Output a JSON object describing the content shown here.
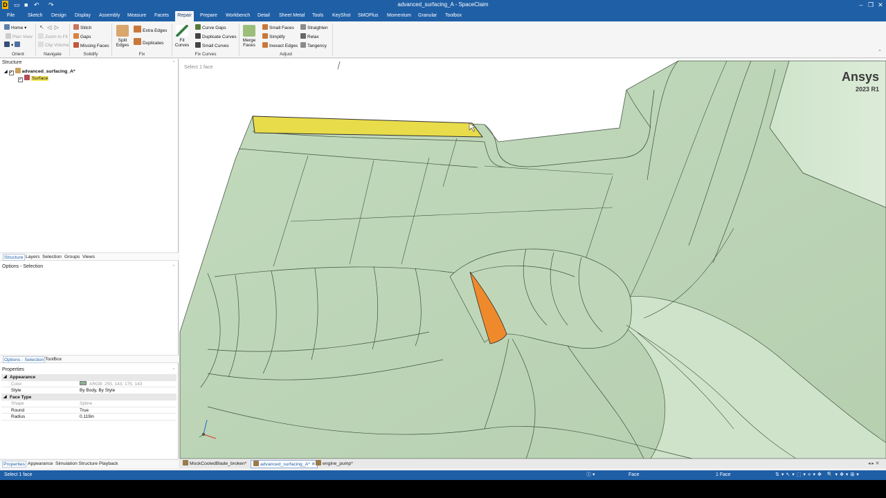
{
  "app": {
    "title": "advanced_surfacing_A - SpaceClaim"
  },
  "menu": {
    "tabs": [
      "File",
      "Sketch",
      "Design",
      "Display",
      "Assembly",
      "Measure",
      "Facets",
      "Repair",
      "Prepare",
      "Workbench",
      "Detail",
      "Sheet Metal",
      "Tools",
      "KeyShot",
      "SMOPlus",
      "Momentum",
      "Granular",
      "Toolbox"
    ],
    "active": "Repair"
  },
  "ribbon": {
    "orient": {
      "home": "Home",
      "plan_view": "Plan View",
      "label": "Orient"
    },
    "navigate": {
      "zoom_to_fit": "Zoom to Fit",
      "clip_volume": "Clip Volume",
      "label": "Navigate"
    },
    "solidify": {
      "stitch": "Stitch",
      "gaps": "Gaps",
      "missing_faces": "Missing Faces",
      "label": "Solidify"
    },
    "fix": {
      "split_edges": "Split\nEdges",
      "extra_edges": "Extra Edges",
      "duplicates": "Duplicates",
      "label": "Fix"
    },
    "fix_curves": {
      "fit_curves": "Fit\nCurves",
      "curve_gaps": "Curve Gaps",
      "duplicate_curves": "Duplicate Curves",
      "small_curves": "Small Curves",
      "label": "Fix Curves"
    },
    "adjust": {
      "merge_faces": "Merge\nFaces",
      "small_faces": "Small Faces",
      "simplify": "Simplify",
      "inexact_edges": "Inexact Edges",
      "straighten": "Straighten",
      "relax": "Relax",
      "tangency": "Tangency",
      "label": "Adjust"
    }
  },
  "structure": {
    "header": "Structure",
    "root": "advanced_surfacing_A*",
    "child": "Surface",
    "tabs": [
      "Structure",
      "Layers",
      "Selection",
      "Groups",
      "Views"
    ]
  },
  "options": {
    "header": "Options - Selection",
    "tabs": [
      "Options - Selection",
      "ToolBox"
    ]
  },
  "properties": {
    "header": "Properties",
    "rows": [
      {
        "type": "cat",
        "key": "Appearance"
      },
      {
        "type": "prop",
        "key": "Color",
        "value": "ARGB: 255, 143, 175, 143",
        "gray": true,
        "swatch": "#8faf8f"
      },
      {
        "type": "prop",
        "key": "Style",
        "value": "By Body, By Style",
        "gray": false
      },
      {
        "type": "cat",
        "key": "Face Type"
      },
      {
        "type": "prop",
        "key": "Shape",
        "value": "Spline",
        "gray": true
      },
      {
        "type": "prop",
        "key": "Round",
        "value": "True",
        "gray": false
      },
      {
        "type": "prop",
        "key": "Radius",
        "value": "0.119in",
        "gray": false
      }
    ],
    "bottom_tabs": [
      "Properties",
      "Appearance",
      "Simulation Structure",
      "Playback"
    ]
  },
  "viewport": {
    "hint": "Select 1 face",
    "brand": "Ansys",
    "version": "2023 R1",
    "surface_color": "#c6dcc0",
    "highlight_yellow": "#e9dc4a",
    "highlight_orange": "#ef8a2c"
  },
  "documents": {
    "tabs": [
      "MockCooledBlade_broken*",
      "advanced_surfacing_A*",
      "engine_pump*"
    ],
    "active_index": 1
  },
  "status": {
    "message": "Select 1 face",
    "mode": "Face",
    "count": "1 Face"
  },
  "colors": {
    "accent": "#1f5fa6"
  }
}
